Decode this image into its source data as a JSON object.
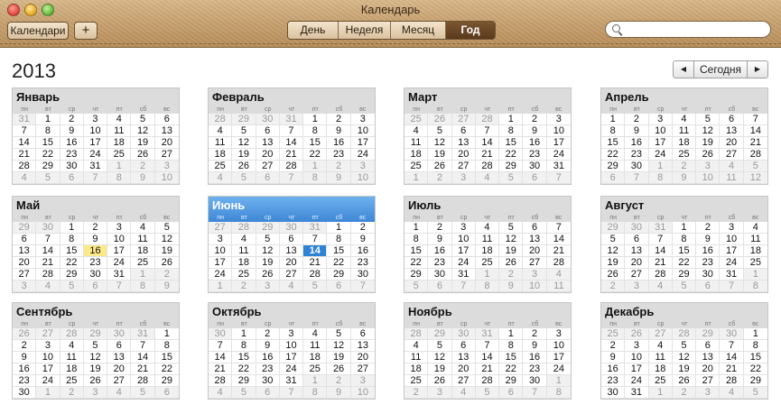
{
  "window": {
    "title": "Календарь"
  },
  "toolbar": {
    "calendars_label": "Календари",
    "add_label": "+",
    "views": [
      {
        "label": "День"
      },
      {
        "label": "Неделя"
      },
      {
        "label": "Месяц"
      },
      {
        "label": "Год"
      }
    ],
    "active_view": "Год",
    "search": {
      "value": "",
      "placeholder": ""
    }
  },
  "year": {
    "label": "2013"
  },
  "nav": {
    "prev": "◀",
    "today_label": "Сегодня",
    "next": "▶"
  },
  "weekdays": [
    "пн",
    "вт",
    "ср",
    "чт",
    "пт",
    "сб",
    "вс"
  ],
  "months": [
    {
      "name": "Январь",
      "lead": [
        "31"
      ],
      "days": 31,
      "trail": [
        "1",
        "2",
        "3",
        "4",
        "5",
        "6",
        "7",
        "8",
        "9",
        "10"
      ]
    },
    {
      "name": "Февраль",
      "lead": [
        "28",
        "29",
        "30",
        "31"
      ],
      "days": 28,
      "trail": [
        "1",
        "2",
        "3",
        "4",
        "5",
        "6",
        "7",
        "8",
        "9",
        "10"
      ]
    },
    {
      "name": "Март",
      "lead": [
        "25",
        "26",
        "27",
        "28"
      ],
      "days": 31,
      "trail": [
        "1",
        "2",
        "3",
        "4",
        "5",
        "6",
        "7"
      ]
    },
    {
      "name": "Апрель",
      "lead": [],
      "days": 30,
      "trail": [
        "1",
        "2",
        "3",
        "4",
        "5",
        "6",
        "7",
        "8",
        "9",
        "10",
        "11",
        "12"
      ]
    },
    {
      "name": "Май",
      "lead": [
        "29",
        "30"
      ],
      "days": 31,
      "trail": [
        "1",
        "2",
        "3",
        "4",
        "5",
        "6",
        "7",
        "8",
        "9"
      ],
      "highlight": 16
    },
    {
      "name": "Июнь",
      "lead": [
        "27",
        "28",
        "29",
        "30",
        "31"
      ],
      "days": 30,
      "trail": [
        "1",
        "2",
        "3",
        "4",
        "5",
        "6",
        "7"
      ],
      "current": true,
      "today": 14
    },
    {
      "name": "Июль",
      "lead": [],
      "days": 31,
      "trail": [
        "1",
        "2",
        "3",
        "4",
        "5",
        "6",
        "7",
        "8",
        "9",
        "10",
        "11"
      ]
    },
    {
      "name": "Август",
      "lead": [
        "29",
        "30",
        "31"
      ],
      "days": 31,
      "trail": [
        "1",
        "2",
        "3",
        "4",
        "5",
        "6",
        "7",
        "8"
      ]
    },
    {
      "name": "Сентябрь",
      "lead": [
        "26",
        "27",
        "28",
        "29",
        "30",
        "31"
      ],
      "days": 30,
      "trail": [
        "1",
        "2",
        "3",
        "4",
        "5",
        "6"
      ]
    },
    {
      "name": "Октябрь",
      "lead": [
        "30"
      ],
      "days": 31,
      "trail": [
        "1",
        "2",
        "3",
        "4",
        "5",
        "6",
        "7",
        "8",
        "9",
        "10"
      ]
    },
    {
      "name": "Ноябрь",
      "lead": [
        "28",
        "29",
        "30",
        "31"
      ],
      "days": 30,
      "trail": [
        "1",
        "2",
        "3",
        "4",
        "5",
        "6",
        "7",
        "8"
      ]
    },
    {
      "name": "Декабрь",
      "lead": [
        "25",
        "26",
        "27",
        "28",
        "29",
        "30"
      ],
      "days": 31,
      "trail": [
        "1",
        "2",
        "3",
        "4",
        "5"
      ]
    }
  ]
}
